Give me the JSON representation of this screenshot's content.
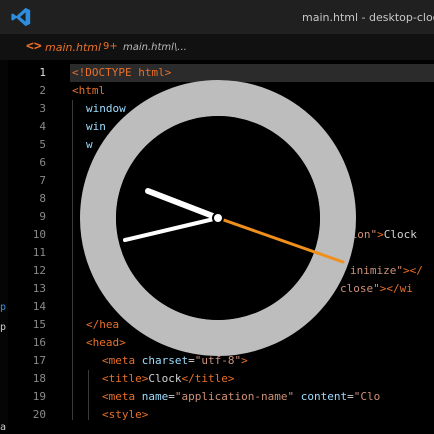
{
  "titlebar": {
    "title": "main.html - desktop-clock"
  },
  "tab": {
    "label": "main.html",
    "dirty": "9+",
    "breadcrumb": "main.html\\..."
  },
  "line_numbers": [
    "1",
    "2",
    "3",
    "4",
    "5",
    "6",
    "7",
    "8",
    "9",
    "10",
    "11",
    "12",
    "13",
    "14",
    "15",
    "16",
    "17",
    "18",
    "19",
    "20"
  ],
  "code": {
    "l1": {
      "tag": "<!DOCTYPE html>"
    },
    "l2": {
      "tag": "<html"
    },
    "l3": {
      "attr": "window"
    },
    "l4": {
      "attr": "win"
    },
    "l5": {
      "attr": "w"
    },
    "l10": {
      "str": "tion\"",
      "tag": ">",
      "txt": "Clock"
    },
    "l12": {
      "str": "inimize\"",
      "tag": "></"
    },
    "l13": {
      "str": "close\"",
      "tag": "></wi"
    },
    "l15": {
      "tag": "</hea"
    },
    "l16": {
      "tag": "<head>"
    },
    "l17": {
      "tag1": "<meta ",
      "attr": "charset",
      "eq": "=",
      "str": "\"utf-8\"",
      "tag2": ">"
    },
    "l18": {
      "tag1": "<title>",
      "txt": "Clock",
      "tag2": "</title>"
    },
    "l19": {
      "tag1": "<meta ",
      "attr1": "name",
      "eq1": "=",
      "str1": "\"application-name\"",
      "attr2": "content",
      "eq2": "=",
      "str2": "\"Clo"
    },
    "l20": {
      "tag": "<style>"
    }
  },
  "clock": {
    "ring_color": "#bdbdbd",
    "face_color": "#000000",
    "hand_color": "#ffffff",
    "second_hand_color": "#f0901c"
  }
}
